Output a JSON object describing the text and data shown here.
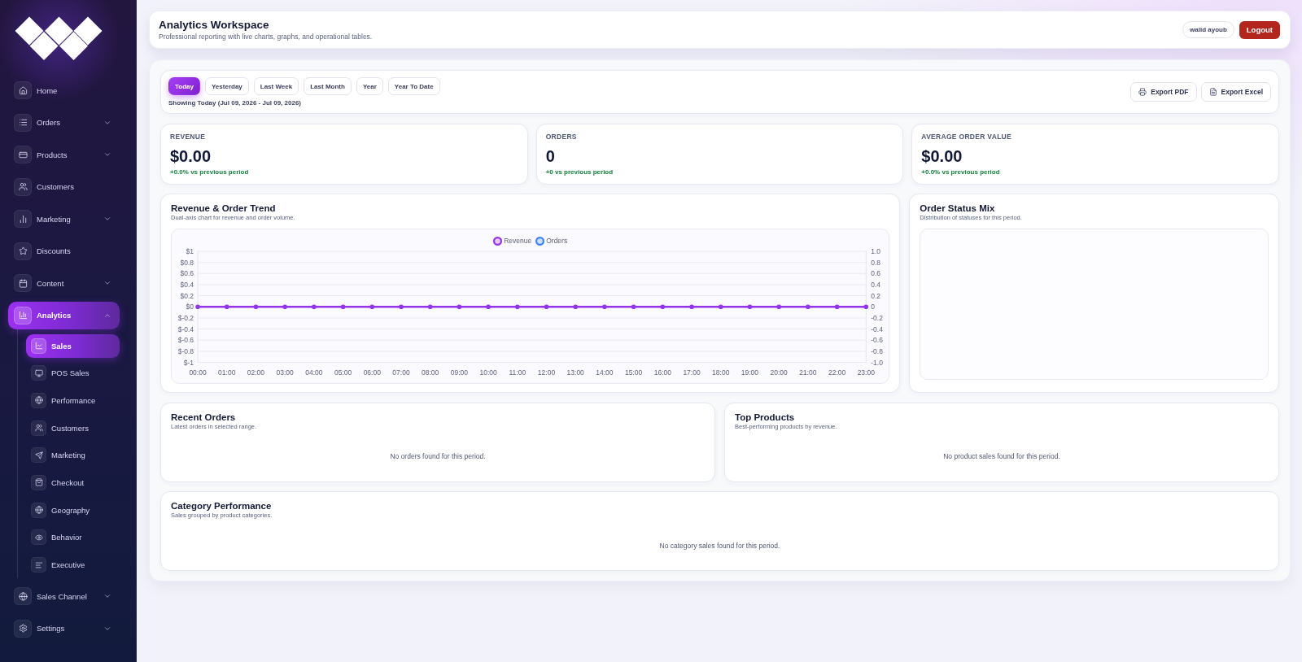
{
  "sidebar": {
    "items": [
      {
        "label": "Home",
        "kind": "link",
        "selected": false
      },
      {
        "label": "Orders",
        "kind": "group",
        "expanded": false,
        "selected": false
      },
      {
        "label": "Products",
        "kind": "group",
        "expanded": false,
        "selected": false
      },
      {
        "label": "Customers",
        "kind": "link",
        "selected": false
      },
      {
        "label": "Marketing",
        "kind": "group",
        "expanded": false,
        "selected": false
      },
      {
        "label": "Discounts",
        "kind": "link",
        "selected": false
      },
      {
        "label": "Content",
        "kind": "group",
        "expanded": false,
        "selected": false
      },
      {
        "label": "Analytics",
        "kind": "group",
        "expanded": true,
        "selected": true,
        "children": [
          {
            "label": "Sales",
            "selected": true
          },
          {
            "label": "POS Sales",
            "selected": false
          },
          {
            "label": "Performance",
            "selected": false
          },
          {
            "label": "Customers",
            "selected": false
          },
          {
            "label": "Marketing",
            "selected": false
          },
          {
            "label": "Checkout",
            "selected": false
          },
          {
            "label": "Geography",
            "selected": false
          },
          {
            "label": "Behavior",
            "selected": false
          },
          {
            "label": "Executive",
            "selected": false
          }
        ]
      },
      {
        "label": "Sales Channel",
        "kind": "group",
        "expanded": false,
        "selected": false
      },
      {
        "label": "Settings",
        "kind": "group",
        "expanded": false,
        "selected": false
      }
    ]
  },
  "header": {
    "title": "Analytics Workspace",
    "subtitle": "Professional reporting with live charts, graphs, and operational tables.",
    "user": "walid ayoub",
    "logout": "Logout"
  },
  "filters": {
    "periods": [
      {
        "label": "Today",
        "selected": true
      },
      {
        "label": "Yesterday",
        "selected": false
      },
      {
        "label": "Last Week",
        "selected": false
      },
      {
        "label": "Last Month",
        "selected": false
      },
      {
        "label": "Year",
        "selected": false
      },
      {
        "label": "Year To Date",
        "selected": false
      }
    ],
    "summary": "Showing Today (Jul 09, 2026 - Jul 09, 2026)",
    "exports": [
      {
        "label": "Export PDF"
      },
      {
        "label": "Export Excel"
      }
    ]
  },
  "kpis": [
    {
      "label": "REVENUE",
      "value": "$0.00",
      "delta": "+0.0% vs previous period"
    },
    {
      "label": "ORDERS",
      "value": "0",
      "delta": "+0 vs previous period"
    },
    {
      "label": "AVERAGE ORDER VALUE",
      "value": "$0.00",
      "delta": "+0.0% vs previous period"
    }
  ],
  "trend_chart": {
    "title": "Revenue & Order Trend",
    "subtitle": "Dual-axis chart for revenue and order volume.",
    "right_axis_labels": [
      "1.0",
      "0.8",
      "0.6",
      "0.4",
      "0.2",
      "0",
      "-0.2",
      "-0.4",
      "-0.6",
      "-0.8",
      "-1.0"
    ],
    "chart_data": {
      "type": "line",
      "categories": [
        "00:00",
        "01:00",
        "02:00",
        "03:00",
        "04:00",
        "05:00",
        "06:00",
        "07:00",
        "08:00",
        "09:00",
        "10:00",
        "11:00",
        "12:00",
        "13:00",
        "14:00",
        "15:00",
        "16:00",
        "17:00",
        "18:00",
        "19:00",
        "20:00",
        "21:00",
        "22:00",
        "23:00"
      ],
      "series": [
        {
          "name": "Revenue",
          "color": "#9333ea",
          "values": [
            0,
            0,
            0,
            0,
            0,
            0,
            0,
            0,
            0,
            0,
            0,
            0,
            0,
            0,
            0,
            0,
            0,
            0,
            0,
            0,
            0,
            0,
            0,
            0
          ]
        },
        {
          "name": "Orders",
          "color": "#3b82f6",
          "values": [
            null,
            null,
            null,
            null,
            null,
            null,
            null,
            null,
            null,
            null,
            null,
            null,
            null,
            null,
            null,
            null,
            null,
            null,
            null,
            null,
            null,
            null,
            null,
            null
          ]
        }
      ],
      "ylim": [
        -1,
        1
      ],
      "yticks": [
        {
          "value": 1,
          "label": "$1"
        },
        {
          "value": 0.8,
          "label": "$0.8"
        },
        {
          "value": 0.6,
          "label": "$0.6"
        },
        {
          "value": 0.4,
          "label": "$0.4"
        },
        {
          "value": 0.2,
          "label": "$0.2"
        },
        {
          "value": 0,
          "label": "$0"
        },
        {
          "value": -0.2,
          "label": "$-0.2"
        },
        {
          "value": -0.4,
          "label": "$-0.4"
        },
        {
          "value": -0.6,
          "label": "$-0.6"
        },
        {
          "value": -0.8,
          "label": "$-0.8"
        },
        {
          "value": -1,
          "label": "$-1"
        }
      ],
      "grid": true,
      "legend": "top"
    }
  },
  "status_mix": {
    "title": "Order Status Mix",
    "subtitle": "Distribution of statuses for this period."
  },
  "recent_orders": {
    "title": "Recent Orders",
    "subtitle": "Latest orders in selected range.",
    "empty_message": "No orders found for this period."
  },
  "top_products": {
    "title": "Top Products",
    "subtitle": "Best-performing products by revenue.",
    "empty_message": "No product sales found for this period."
  },
  "category_performance": {
    "title": "Category Performance",
    "subtitle": "Sales grouped by product categories.",
    "empty_message": "No category sales found for this period."
  }
}
